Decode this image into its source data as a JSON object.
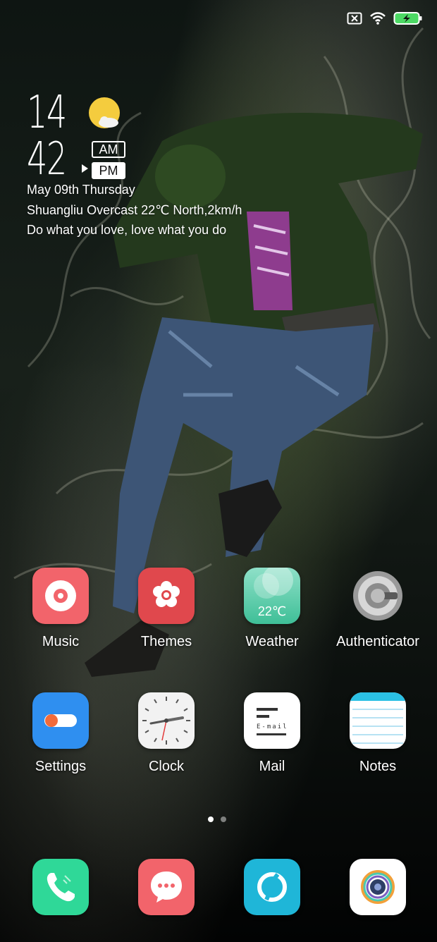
{
  "status_bar": {
    "icons": [
      "no-sim-icon",
      "wifi-icon",
      "battery-charging-icon"
    ],
    "battery_color": "#4cd964"
  },
  "clock_widget": {
    "hour": "14",
    "minute": "42",
    "am_label": "AM",
    "pm_label": "PM",
    "selected_period": "PM",
    "weather_icon": "partly-cloudy-sun-icon",
    "date_line": "May 09th Thursday",
    "weather_line": "Shuangliu Overcast 22℃ North,2km/h",
    "quote_line": "Do what you love, love what you do"
  },
  "apps": [
    {
      "label": "Music",
      "icon": "music-icon",
      "color": "#f2646b"
    },
    {
      "label": "Themes",
      "icon": "themes-icon",
      "color": "#e0484d"
    },
    {
      "label": "Weather",
      "icon": "weather-icon",
      "color": "#4ec9a3",
      "icon_text": "22℃"
    },
    {
      "label": "Authenticator",
      "icon": "authenticator-icon",
      "color": "#8a8a8a"
    },
    {
      "label": "Settings",
      "icon": "settings-icon",
      "color": "#2f8ff0"
    },
    {
      "label": "Clock",
      "icon": "clock-icon",
      "color": "#f2f2f2"
    },
    {
      "label": "Mail",
      "icon": "mail-icon",
      "color": "#ffffff",
      "icon_text": "E-mail"
    },
    {
      "label": "Notes",
      "icon": "notes-icon",
      "color": "#ffffff"
    }
  ],
  "pager": {
    "pages": 2,
    "current": 1
  },
  "dock": [
    {
      "icon": "phone-icon",
      "color": "#2fd898"
    },
    {
      "icon": "messages-icon",
      "color": "#f2646b"
    },
    {
      "icon": "browser-icon",
      "color": "#1fb6d8"
    },
    {
      "icon": "camera-icon",
      "color": "#ffffff"
    }
  ]
}
